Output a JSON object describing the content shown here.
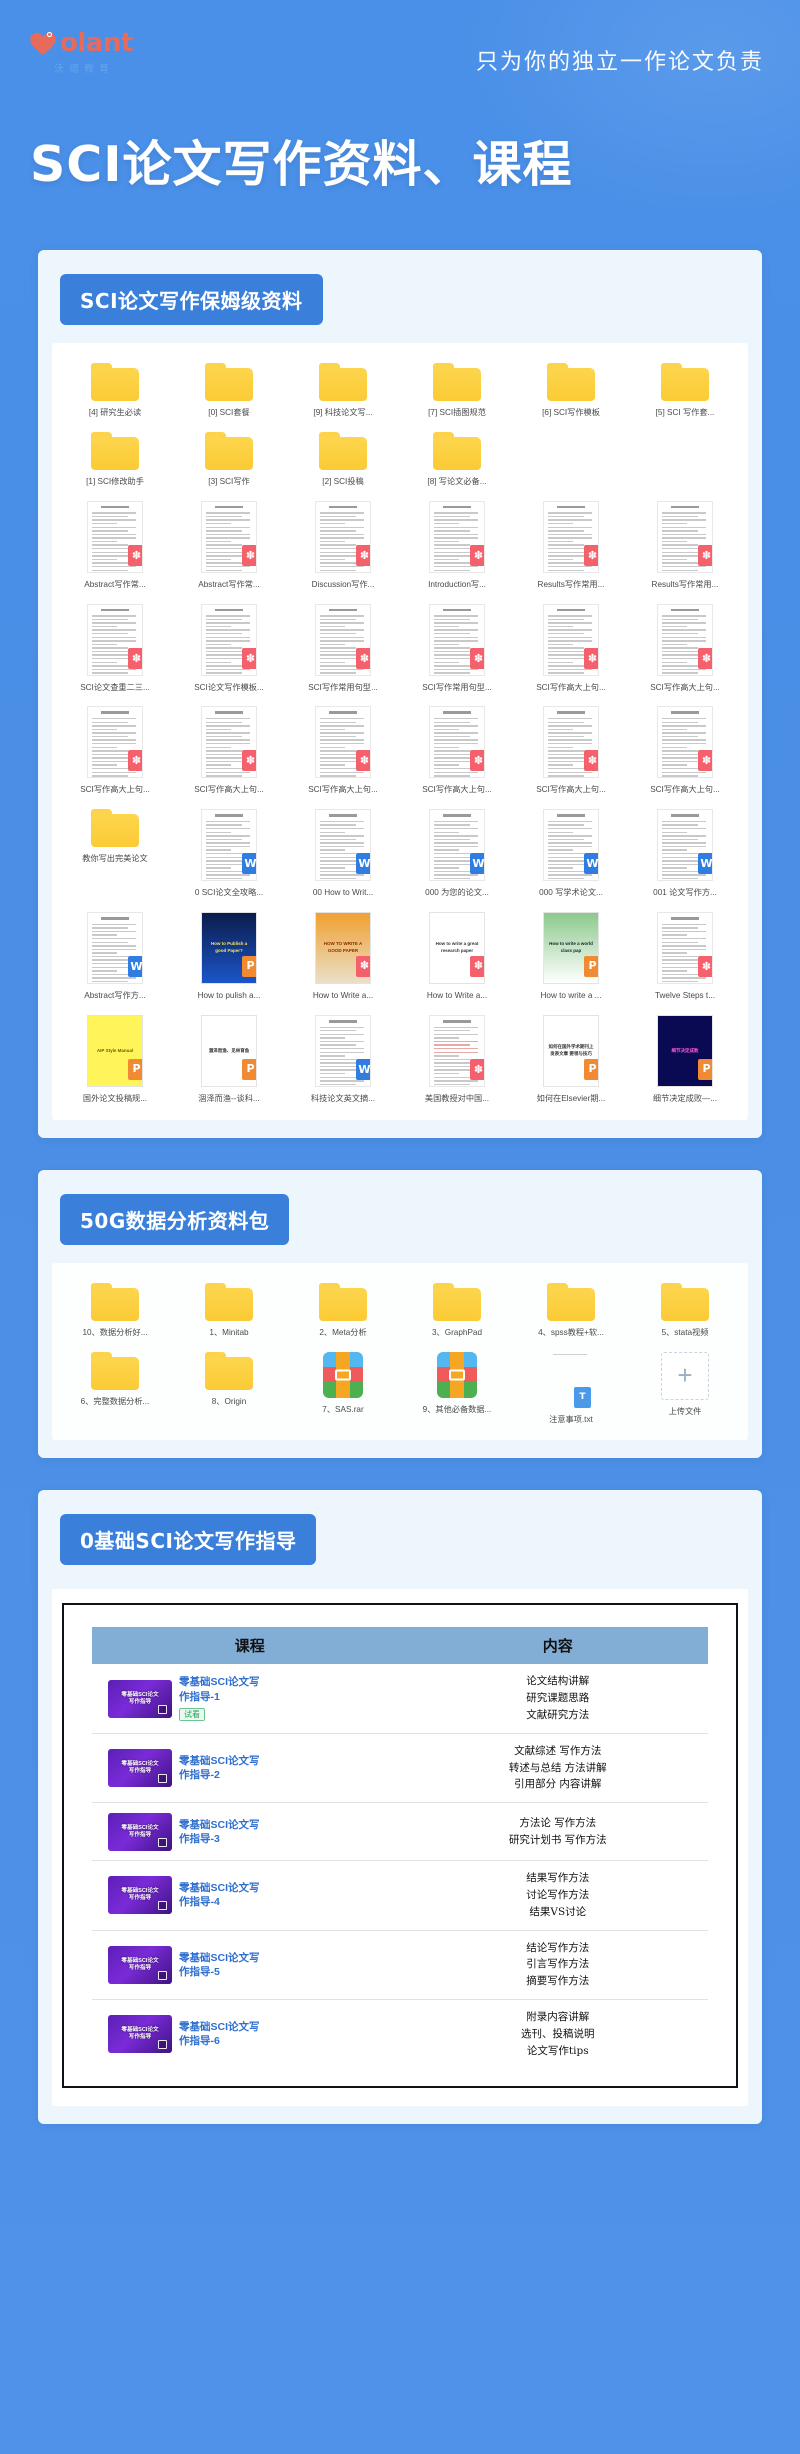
{
  "header": {
    "logo_text": "olant",
    "logo_sub": "沃德教育",
    "tagline": "只为你的独立一作论文负责",
    "main_title": "SCI论文写作资料、课程",
    "accent_color": "#4a90e8",
    "logo_color": "#e86a5a"
  },
  "sections": [
    {
      "tag": "SCI论文写作保姆级资料",
      "rows": [
        {
          "type": "folder",
          "items": [
            {
              "label": "[4] 研究生必读"
            },
            {
              "label": "[0] SCI套餐"
            },
            {
              "label": "[9] 科技论文写..."
            },
            {
              "label": "[7] SCI插图规范"
            },
            {
              "label": "[6] SCI写作模板"
            },
            {
              "label": "[5] SCI 写作套..."
            }
          ]
        },
        {
          "type": "folder",
          "items": [
            {
              "label": "[1] SCI修改助手"
            },
            {
              "label": "[3] SCI写作"
            },
            {
              "label": "[2] SCI投稿"
            },
            {
              "label": "[8] 写论文必备..."
            },
            {
              "label": "",
              "empty": true
            },
            {
              "label": "",
              "empty": true
            }
          ]
        },
        {
          "type": "doc",
          "items": [
            {
              "label": "Abstract写作常...",
              "icon": "pdf"
            },
            {
              "label": "Abstract写作常...",
              "icon": "pdf"
            },
            {
              "label": "Discussion写作...",
              "icon": "pdf"
            },
            {
              "label": "Introduction写...",
              "icon": "pdf"
            },
            {
              "label": "Results写作常用...",
              "icon": "pdf"
            },
            {
              "label": "Results写作常用...",
              "icon": "pdf"
            }
          ]
        },
        {
          "type": "doc",
          "items": [
            {
              "label": "SCI论文查重二三...",
              "icon": "pdf"
            },
            {
              "label": "SCI论文写作模板...",
              "icon": "pdf"
            },
            {
              "label": "SCI写作常用句型...",
              "icon": "pdf"
            },
            {
              "label": "SCI写作常用句型...",
              "icon": "pdf"
            },
            {
              "label": "SCI写作高大上句...",
              "icon": "pdf"
            },
            {
              "label": "SCI写作高大上句...",
              "icon": "pdf"
            }
          ]
        },
        {
          "type": "doc",
          "items": [
            {
              "label": "SCI写作高大上句...",
              "icon": "pdf"
            },
            {
              "label": "SCI写作高大上句...",
              "icon": "pdf"
            },
            {
              "label": "SCI写作高大上句...",
              "icon": "pdf"
            },
            {
              "label": "SCI写作高大上句...",
              "icon": "pdf"
            },
            {
              "label": "SCI写作高大上句...",
              "icon": "pdf"
            },
            {
              "label": "SCI写作高大上句...",
              "icon": "pdf"
            }
          ]
        },
        {
          "type": "mixed",
          "items": [
            {
              "label": "教你写出完美论文",
              "icon": "folder"
            },
            {
              "label": "0 SCI论文全攻略...",
              "icon": "word"
            },
            {
              "label": "00 How to Writ...",
              "icon": "word"
            },
            {
              "label": "000 为您的论文...",
              "icon": "word"
            },
            {
              "label": "000 写学术论文...",
              "icon": "word"
            },
            {
              "label": "001 论文写作方...",
              "icon": "word"
            }
          ]
        },
        {
          "type": "cover",
          "items": [
            {
              "label": "Abstract写作方...",
              "icon": "word",
              "cover": "plain"
            },
            {
              "label": "How to pulish a...",
              "icon": "ppt",
              "cover": "blue",
              "cover_text": "How to Publish a good Paper?"
            },
            {
              "label": "How to Write a...",
              "icon": "pdf",
              "cover": "orange",
              "cover_text": "HOW TO WRITE A GOOD PAPER"
            },
            {
              "label": "How to Write a...",
              "icon": "pdf",
              "cover": "white",
              "cover_text": "How to write a great research paper"
            },
            {
              "label": "How to write a ...",
              "icon": "ppt",
              "cover": "green",
              "cover_text": "How to write a world class pap"
            },
            {
              "label": "Twelve Steps t...",
              "icon": "pdf",
              "cover": "plain"
            }
          ]
        },
        {
          "type": "cover",
          "items": [
            {
              "label": "国外论文投稿规...",
              "icon": "ppt",
              "cover": "yellow",
              "cover_text": "AIP Style Manual"
            },
            {
              "label": "涸泽而渔--谈科...",
              "icon": "ppt",
              "cover": "white",
              "cover_text": "涸泽而渔、见林育鱼"
            },
            {
              "label": "科技论文英文摘...",
              "icon": "word",
              "cover": "plain"
            },
            {
              "label": "美国教授对中国...",
              "icon": "pdf",
              "cover": "plain"
            },
            {
              "label": "如何在Elsevier期...",
              "icon": "ppt",
              "cover": "white",
              "cover_text": "如何在国外学术期刊上发表文章 要领与技巧"
            },
            {
              "label": "细节决定成败—...",
              "icon": "ppt",
              "cover": "navy",
              "cover_text": "细节决定成败"
            }
          ]
        }
      ]
    },
    {
      "tag": "50G数据分析资料包",
      "rows": [
        {
          "type": "folder",
          "items": [
            {
              "label": "10、数据分析好..."
            },
            {
              "label": "1、Minitab"
            },
            {
              "label": "2、Meta分析"
            },
            {
              "label": "3、GraphPad"
            },
            {
              "label": "4、spss教程+软..."
            },
            {
              "label": "5、stata视频"
            }
          ]
        },
        {
          "type": "mixed2",
          "items": [
            {
              "label": "6、完整数据分析...",
              "icon": "folder"
            },
            {
              "label": "8、Origin",
              "icon": "folder"
            },
            {
              "label": "7、SAS.rar",
              "icon": "rar"
            },
            {
              "label": "9、其他必备数据...",
              "icon": "rar"
            },
            {
              "label": "注意事项.txt",
              "icon": "txt"
            },
            {
              "label": "上传文件",
              "icon": "upload"
            }
          ]
        }
      ]
    }
  ],
  "course_section": {
    "tag": "0基础SCI论文写作指导",
    "table": {
      "headers": [
        "课程",
        "内容"
      ],
      "rows": [
        {
          "thumb_text": "零基础SCI论文\n写作指导",
          "title": "零基础SCI论文写\n作指导-1",
          "trial": "试看",
          "content": "论文结构讲解\n研究课题思路\n文献研究方法"
        },
        {
          "thumb_text": "零基础SCI论文\n写作指导",
          "title": "零基础SCI论文写\n作指导-2",
          "trial": "",
          "content": "文献综述  写作方法\n转述与总结  方法讲解\n引用部分  内容讲解"
        },
        {
          "thumb_text": "零基础SCI论文\n写作指导",
          "title": "零基础SCI论文写\n作指导-3",
          "trial": "",
          "content": "方法论  写作方法\n研究计划书  写作方法"
        },
        {
          "thumb_text": "零基础SCI论文\n写作指导",
          "title": "零基础SCI论文写\n作指导-4",
          "trial": "",
          "content": "结果写作方法\n讨论写作方法\n结果VS讨论"
        },
        {
          "thumb_text": "零基础SCI论文\n写作指导",
          "title": "零基础SCI论文写\n作指导-5",
          "trial": "",
          "content": "结论写作方法\n引言写作方法\n摘要写作方法"
        },
        {
          "thumb_text": "零基础SCI论文\n写作指导",
          "title": "零基础SCI论文写\n作指导-6",
          "trial": "",
          "content": "附录内容讲解\n选刊、投稿说明\n论文写作tips"
        }
      ]
    }
  }
}
